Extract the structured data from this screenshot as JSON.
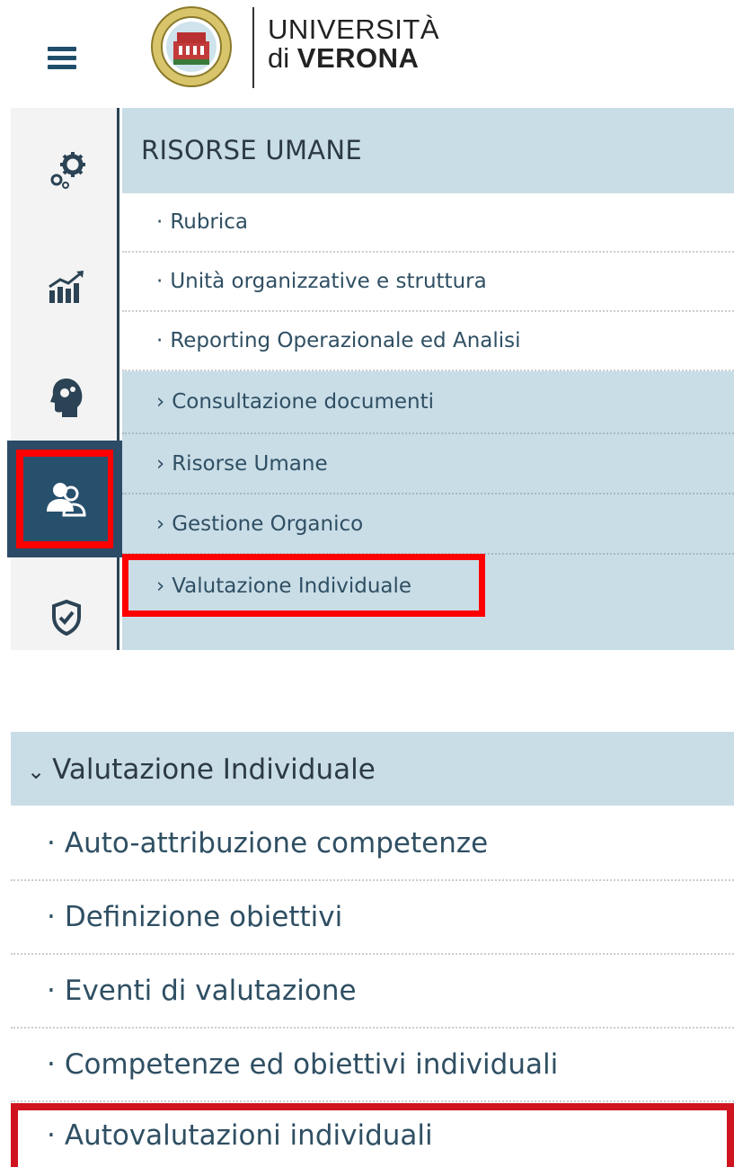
{
  "header": {
    "logo_line1": "UNIVERSITÀ",
    "logo_line2_prefix": "di",
    "logo_line2_bold": "VERONA",
    "menu_icon": "hamburger-icon"
  },
  "sidebar": {
    "icons": [
      "gears-icon",
      "chart-icon",
      "head-gears-icon",
      "users-icon",
      "shield-check-icon"
    ],
    "active": "users-icon"
  },
  "menu_panel": {
    "title": "RISORSE UMANE",
    "items": [
      {
        "prefix": "·",
        "label": "Rubrica"
      },
      {
        "prefix": "·",
        "label": "Unità organizzative e struttura"
      },
      {
        "prefix": "·",
        "label": "Reporting Operazionale ed Analisi"
      },
      {
        "prefix": "›",
        "label": "Consultazione documenti"
      },
      {
        "prefix": "›",
        "label": "Risorse Umane"
      },
      {
        "prefix": "›",
        "label": "Gestione Organico"
      },
      {
        "prefix": "›",
        "label": "Valutazione Individuale"
      }
    ]
  },
  "submenu": {
    "title_prefix": "⌄",
    "title": "Valutazione Individuale",
    "items": [
      {
        "prefix": "·",
        "label": "Auto-attribuzione competenze"
      },
      {
        "prefix": "·",
        "label": "Definizione obiettivi"
      },
      {
        "prefix": "·",
        "label": "Eventi di valutazione"
      },
      {
        "prefix": "·",
        "label": "Competenze ed obiettivi individuali"
      },
      {
        "prefix": "·",
        "label": "Autovalutazioni individuali"
      }
    ]
  },
  "colors": {
    "panel_bg": "#c9dde7",
    "sidebar_active": "#27506d",
    "highlight": "#ff0000"
  }
}
